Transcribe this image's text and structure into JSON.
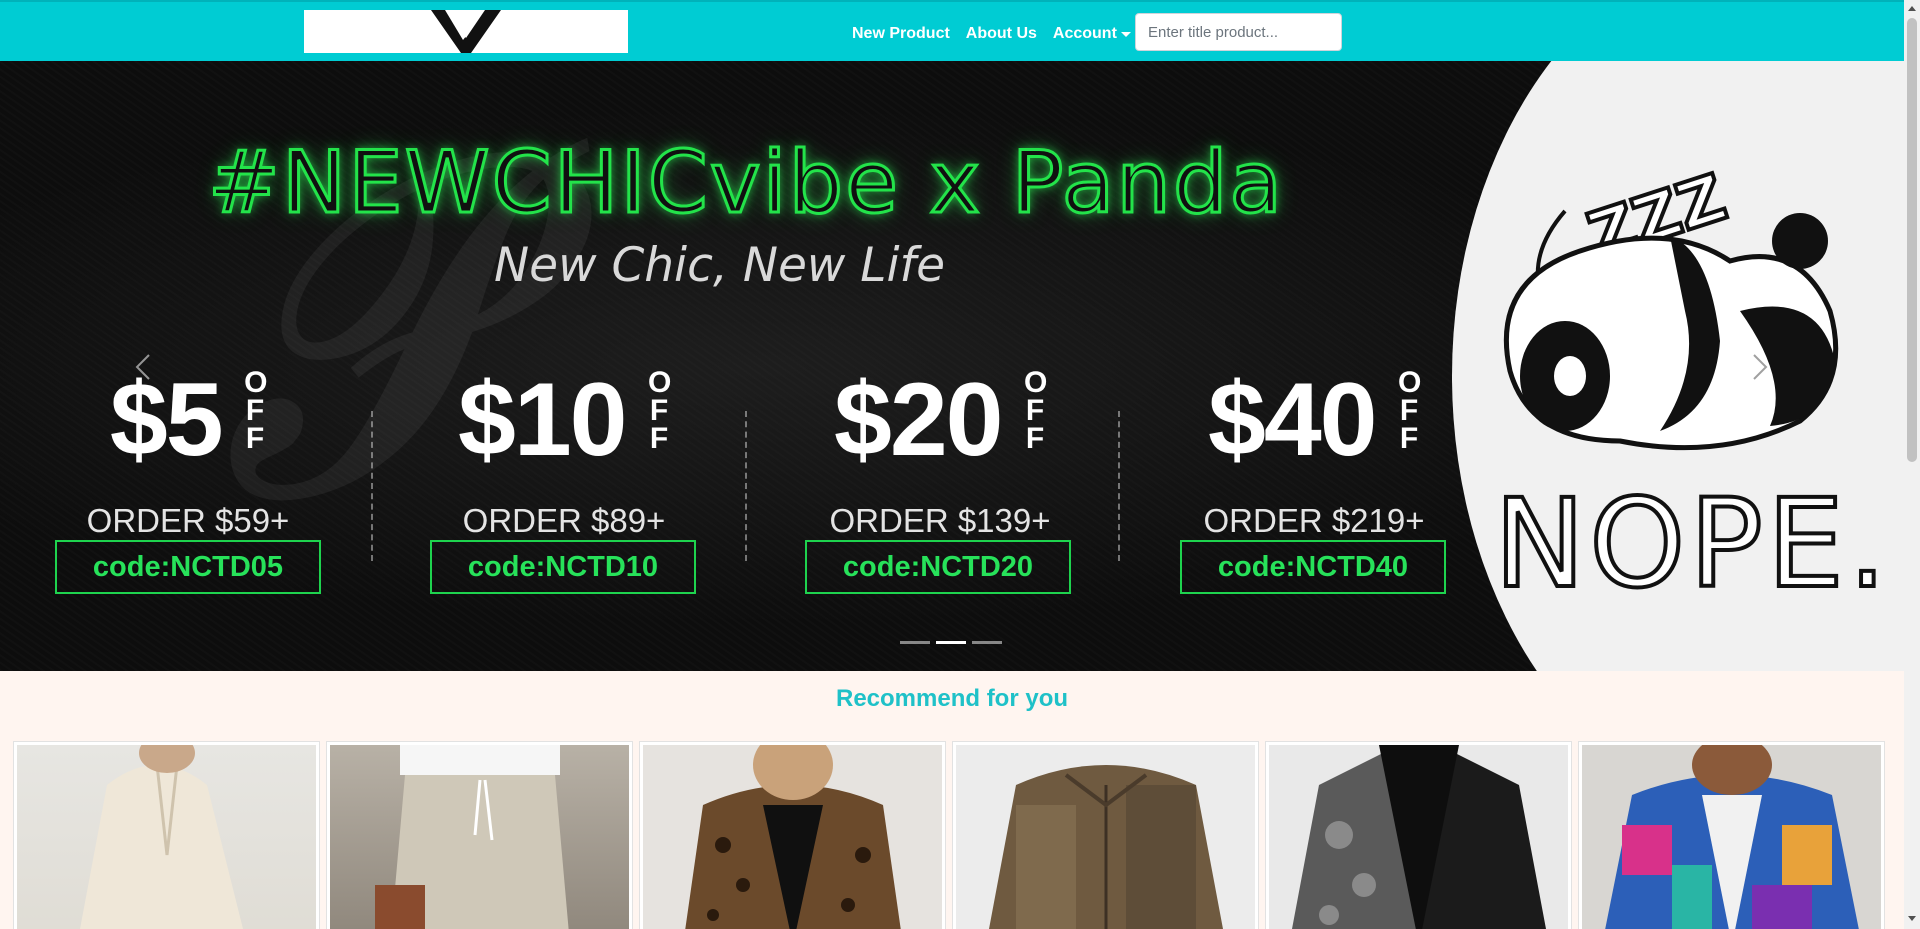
{
  "navbar": {
    "bg_color": "#00ccd3",
    "logo_icon": "v-logo-icon",
    "links": {
      "new_product": "New Product",
      "about_us": "About Us",
      "account": "Account"
    },
    "search": {
      "placeholder": "Enter title product...",
      "value": ""
    }
  },
  "banner": {
    "headline": "#NEWCHICvibe x Panda",
    "subline": "New Chic, New Life",
    "off_label": "OFF",
    "deals": [
      {
        "amount": "$5",
        "order": "ORDER $59+",
        "code": "code:NCTD05"
      },
      {
        "amount": "$10",
        "order": "ORDER $89+",
        "code": "code:NCTD10"
      },
      {
        "amount": "$20",
        "order": "ORDER $139+",
        "code": "code:NCTD20"
      },
      {
        "amount": "$40",
        "order": "ORDER $219+",
        "code": "code:NCTD40"
      }
    ],
    "sleep_text": "ZZZ",
    "nope_text": "NOPE.",
    "indicators_count": 3,
    "active_indicator": 2,
    "accent_color": "#23e34a"
  },
  "recommend": {
    "title": "Recommend for you",
    "title_color": "#1fc1c8",
    "products": [
      {
        "image": "cream-shirt-dress"
      },
      {
        "image": "linen-drawstring-pants"
      },
      {
        "image": "leopard-print-blazer"
      },
      {
        "image": "brown-plaid-shirt"
      },
      {
        "image": "black-paisley-kimono"
      },
      {
        "image": "colorful-patchwork-jacket"
      }
    ]
  }
}
